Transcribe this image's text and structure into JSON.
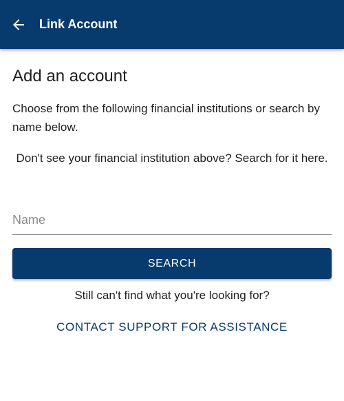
{
  "app_bar": {
    "title": "Link Account",
    "back_icon": "arrow-left-icon",
    "background": "#073b6e"
  },
  "main": {
    "heading": "Add an account",
    "intro": "Choose from the following financial institutions or search by name below.",
    "note": "Don't see your financial institution above? Search for it here.",
    "search": {
      "placeholder": "Name",
      "value": ""
    },
    "search_button_label": "SEARCH",
    "still_text": "Still can't find what you're looking for?",
    "contact_link_label": "CONTACT SUPPORT FOR ASSISTANCE"
  },
  "colors": {
    "brand": "#073b6e",
    "text": "#212121",
    "placeholder": "#8a8a8a"
  }
}
